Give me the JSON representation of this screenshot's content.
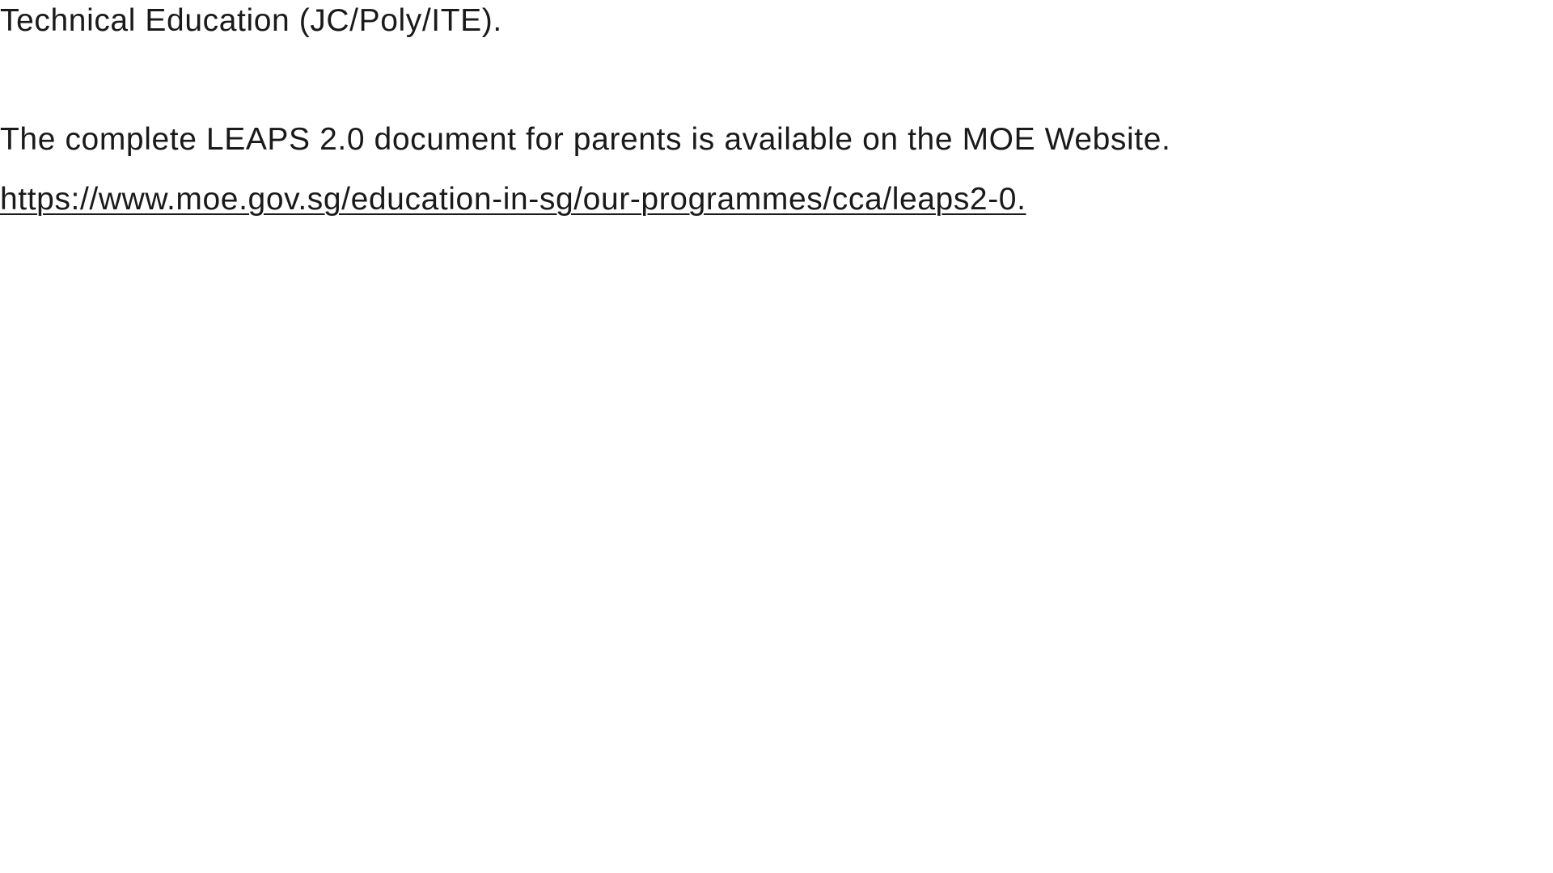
{
  "document": {
    "paragraph_1": "Technical Education (JC/Poly/ITE).",
    "paragraph_2": "The complete LEAPS 2.0 document for parents is available on the MOE Website.",
    "link_text": "https://www.moe.gov.sg/education-in-sg/our-programmes/cca/leaps2-0."
  },
  "colors": {
    "text": "#1a1a1a",
    "background": "#ffffff"
  }
}
